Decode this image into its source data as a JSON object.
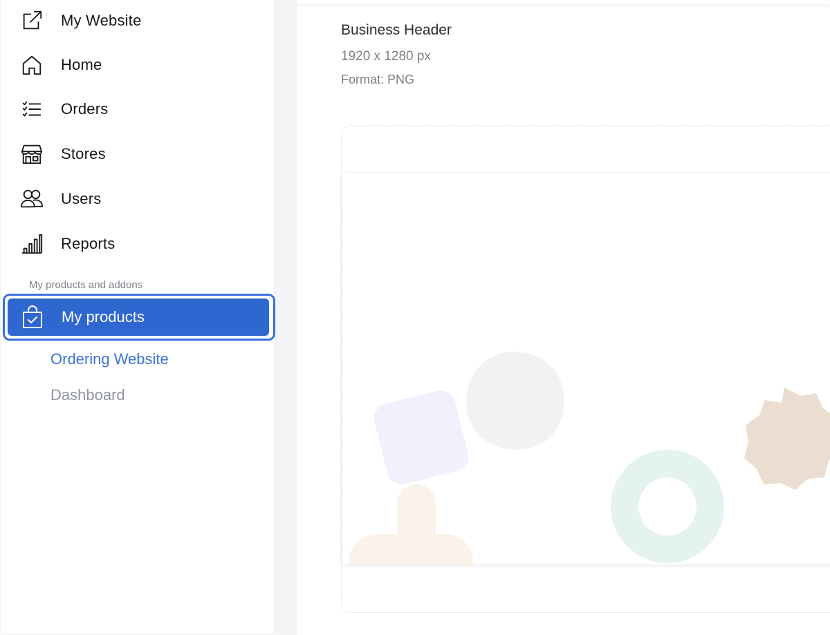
{
  "sidebar": {
    "items": [
      {
        "label": "My Website",
        "icon": "external-link-icon"
      },
      {
        "label": "Home",
        "icon": "home-icon"
      },
      {
        "label": "Orders",
        "icon": "list-icon"
      },
      {
        "label": "Stores",
        "icon": "store-icon"
      },
      {
        "label": "Users",
        "icon": "users-icon"
      },
      {
        "label": "Reports",
        "icon": "bar-chart-icon"
      }
    ],
    "section_caption": "My products and addons",
    "active_item": {
      "label": "My products",
      "icon": "shopping-bag-icon"
    },
    "sub_items": [
      {
        "label": "Ordering Website",
        "current": true
      },
      {
        "label": "Dashboard",
        "current": false
      }
    ]
  },
  "asset": {
    "title": "Business Header",
    "dimensions": "1920 x 1280 px",
    "format": "Format: PNG",
    "faint_text": "p"
  },
  "colors": {
    "active_bg": "#2f67d0",
    "active_border": "#3b6fe0",
    "current_sub": "#3a73d8",
    "muted_sub": "#8f949c",
    "shape_lavender": "#f3f0fd",
    "shape_gray": "#f2f2f2",
    "shape_mint": "#e4f3ec",
    "shape_tan": "#ecddd1",
    "shape_peach": "#fbf2ea"
  }
}
